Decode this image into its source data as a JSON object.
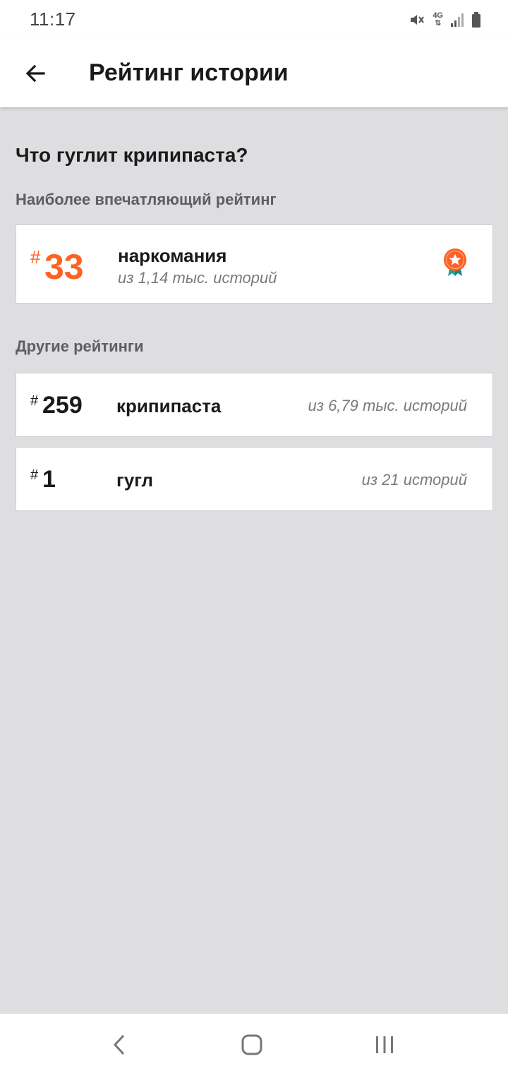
{
  "status": {
    "time": "11:17",
    "network_type": "4G",
    "icons": [
      "mute-icon",
      "network-4g-icon",
      "signal-icon",
      "battery-icon"
    ]
  },
  "header": {
    "title": "Рейтинг истории",
    "back_icon": "arrow-left-icon"
  },
  "story": {
    "title": "Что гуглит крипипаста?"
  },
  "top_rating": {
    "section_label": "Наиболее впечатляющий рейтинг",
    "hash": "#",
    "rank": "33",
    "tag": "наркомания",
    "count_text": "из 1,14 тыс. историй",
    "badge_icon": "award-medal-icon",
    "accent_color": "#ff6122"
  },
  "other_ratings": {
    "section_label": "Другие рейтинги",
    "items": [
      {
        "hash": "#",
        "rank": "259",
        "tag": "крипипаста",
        "count_text": "из 6,79 тыс. историй"
      },
      {
        "hash": "#",
        "rank": "1",
        "tag": "гугл",
        "count_text": "из 21 историй"
      }
    ]
  },
  "nav": {
    "back_icon": "nav-back-icon",
    "home_icon": "nav-home-icon",
    "recent_icon": "nav-recent-apps-icon"
  }
}
